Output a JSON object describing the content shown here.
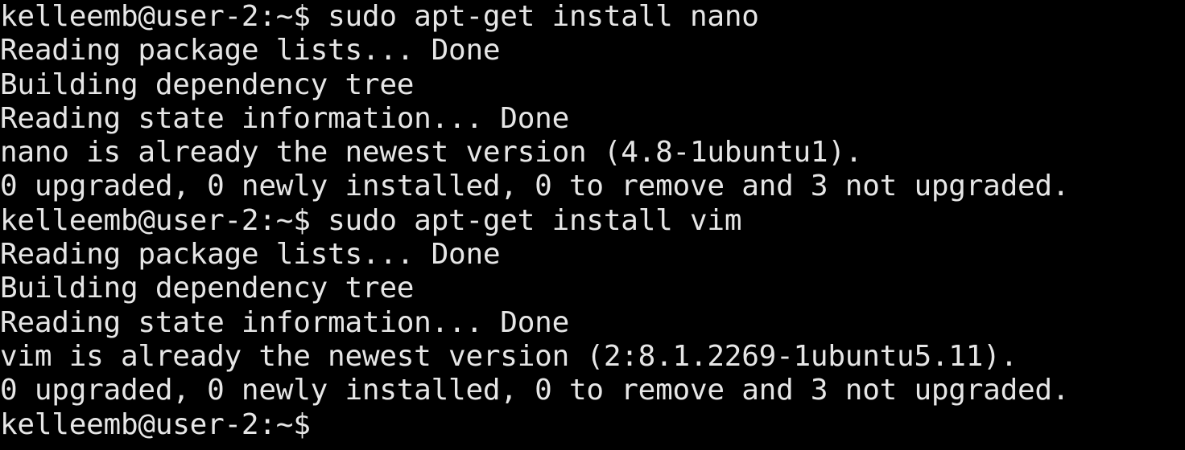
{
  "terminal": {
    "lines": [
      {
        "prompt": "kelleemb@user-2:~$",
        "command": " sudo apt-get install nano"
      },
      {
        "text": "Reading package lists... Done"
      },
      {
        "text": "Building dependency tree"
      },
      {
        "text": "Reading state information... Done"
      },
      {
        "text": "nano is already the newest version (4.8-1ubuntu1)."
      },
      {
        "text": "0 upgraded, 0 newly installed, 0 to remove and 3 not upgraded."
      },
      {
        "prompt": "kelleemb@user-2:~$",
        "command": " sudo apt-get install vim"
      },
      {
        "text": "Reading package lists... Done"
      },
      {
        "text": "Building dependency tree"
      },
      {
        "text": "Reading state information... Done"
      },
      {
        "text": "vim is already the newest version (2:8.1.2269-1ubuntu5.11)."
      },
      {
        "text": "0 upgraded, 0 newly installed, 0 to remove and 3 not upgraded."
      },
      {
        "prompt": "kelleemb@user-2:~$",
        "command": ""
      }
    ],
    "colors": {
      "background": "#000000",
      "foreground": "#e6e6e6"
    }
  }
}
